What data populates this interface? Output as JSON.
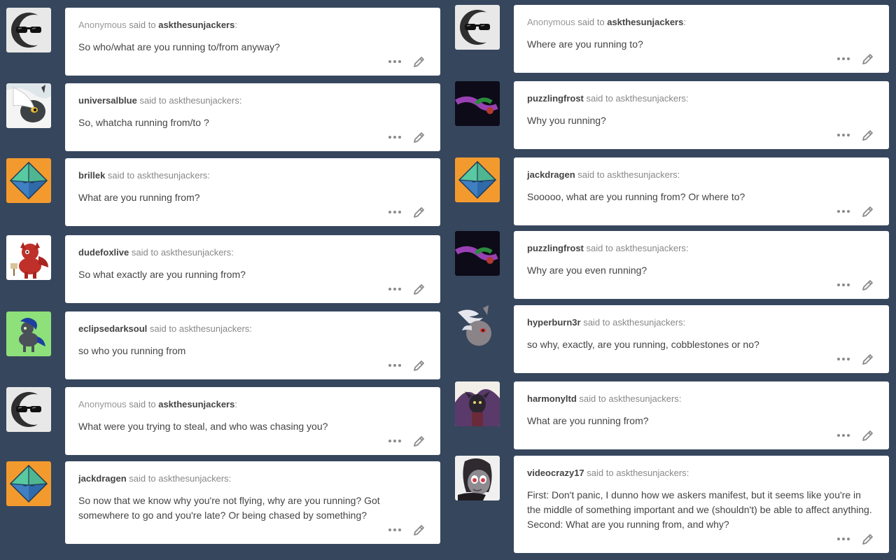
{
  "connector": "said to",
  "blog_name": "askthesunjackers",
  "left": [
    {
      "user": "Anonymous",
      "anon": true,
      "avatar": "anonymous-sunglasses-avatar",
      "text": "So who/what are you running to/from anyway?"
    },
    {
      "user": "universalblue",
      "anon": false,
      "avatar": "white-haired-pony-avatar",
      "text": "So, whatcha running from/to ?"
    },
    {
      "user": "brillek",
      "anon": false,
      "avatar": "octahedron-avatar",
      "text": "What are you running from?"
    },
    {
      "user": "dudefoxlive",
      "anon": false,
      "avatar": "red-fox-pony-avatar",
      "text": "So what exactly are you running from?"
    },
    {
      "user": "eclipsedarksoul",
      "anon": false,
      "avatar": "dark-pony-avatar",
      "text": "so who you running from"
    },
    {
      "user": "Anonymous",
      "anon": true,
      "avatar": "anonymous-sunglasses-avatar",
      "text": "What were you trying to steal, and who was chasing you?"
    },
    {
      "user": "jackdragen",
      "anon": false,
      "avatar": "octahedron-avatar",
      "text": "So now that we know why you're not flying, why are you running? Got somewhere to go and you're late? Or being chased by something?"
    }
  ],
  "right": [
    {
      "user": "Anonymous",
      "anon": true,
      "avatar": "anonymous-sunglasses-avatar",
      "text": "Where are you running to?"
    },
    {
      "user": "puzzlingfrost",
      "anon": false,
      "avatar": "purple-glow-avatar",
      "text": "Why you running?"
    },
    {
      "user": "jackdragen",
      "anon": false,
      "avatar": "octahedron-avatar",
      "text": "Sooooo, what are you running from? Or where to?"
    },
    {
      "user": "puzzlingfrost",
      "anon": false,
      "avatar": "purple-glow-avatar",
      "text": "Why are you even running?"
    },
    {
      "user": "hyperburn3r",
      "anon": false,
      "avatar": "grey-pony-avatar",
      "text": "so why, exactly, are you running, cobblestones or no?"
    },
    {
      "user": "harmonyltd",
      "anon": false,
      "avatar": "dark-dragon-avatar",
      "text": "What are you running from?"
    },
    {
      "user": "videocrazy17",
      "anon": false,
      "avatar": "pony-headphones-avatar",
      "text": "First: Don't panic, I dunno how we askers manifest, but it seems like you're in the middle of something important and we (shouldn't) be able to affect anything. Second: What are you running from, and why?"
    }
  ],
  "colors": {
    "background": "#36465d",
    "card": "#ffffff",
    "octahedron_bg": "#f29a2e",
    "octa_green": "#58c9a0",
    "octa_blue": "#3f7fc2"
  }
}
